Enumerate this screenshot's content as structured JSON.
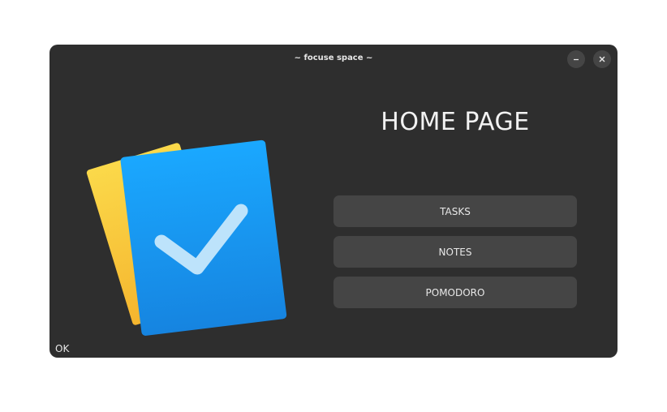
{
  "window": {
    "title": "~ focuse space ~"
  },
  "controls": {
    "minimize_icon": "minimize-icon",
    "close_icon": "close-icon"
  },
  "main": {
    "heading": "HOME PAGE",
    "buttons": [
      {
        "label": "TASKS"
      },
      {
        "label": "NOTES"
      },
      {
        "label": "POMODORO"
      }
    ]
  },
  "illustration": {
    "icon": "checklist-icon",
    "colors": {
      "back_page": "#f7c93a",
      "front_page_top": "#1aa8ff",
      "front_page_bottom": "#1684e0",
      "check": "#bde3fb"
    }
  },
  "status_bar": {
    "text": "OK"
  },
  "theme": {
    "window_bg": "#2e2e2e",
    "button_bg": "#454545",
    "text": "#e8e8e8"
  }
}
